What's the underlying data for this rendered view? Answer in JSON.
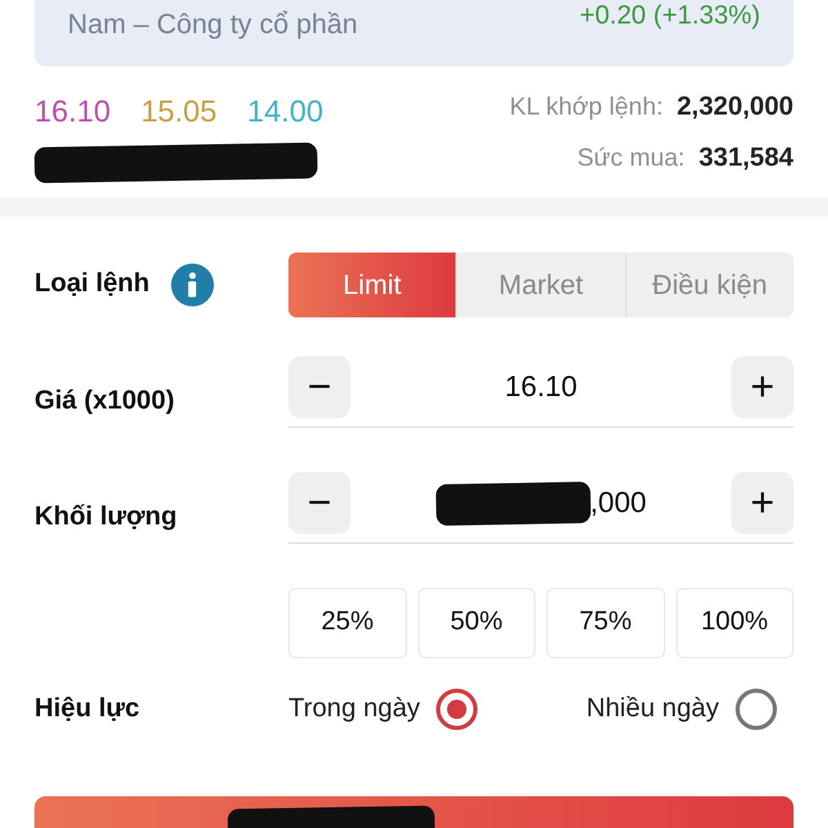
{
  "stock_card": {
    "subtitle": "Nam – Công ty cổ phần",
    "change": "+0.20 (+1.33%)"
  },
  "prices": [
    {
      "value": "16.10",
      "color": "#c04fb4"
    },
    {
      "value": "15.05",
      "color": "#c9a040"
    },
    {
      "value": "14.00",
      "color": "#3fb3c9"
    }
  ],
  "stats": [
    {
      "label": "KL khớp lệnh:",
      "value": "2,320,000"
    },
    {
      "label": "Sức mua:",
      "value": "331,584"
    }
  ],
  "order_type": {
    "label": "Loại lệnh",
    "options": [
      {
        "label": "Limit",
        "selected": true
      },
      {
        "label": "Market",
        "selected": false
      },
      {
        "label": "Điều kiện",
        "selected": false
      }
    ]
  },
  "price": {
    "label": "Giá (x1000)",
    "value": "16.10",
    "minus": "−",
    "plus": "+"
  },
  "quantity": {
    "label": "Khối lượng",
    "value": ",000",
    "minus": "−",
    "plus": "+"
  },
  "percent_buttons": [
    "25%",
    "50%",
    "75%",
    "100%"
  ],
  "validity": {
    "label": "Hiệu lực",
    "options": [
      {
        "label": "Trong ngày",
        "selected": true
      },
      {
        "label": "Nhiều ngày",
        "selected": false
      }
    ]
  }
}
